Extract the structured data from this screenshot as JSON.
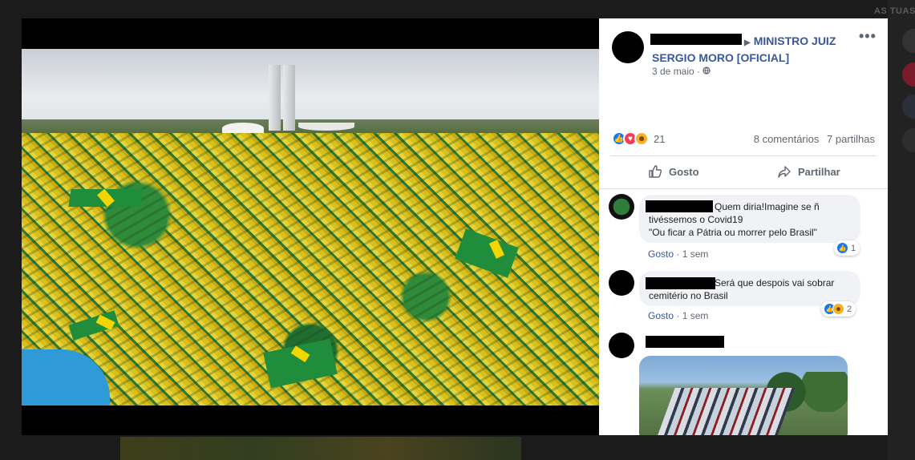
{
  "background": {
    "right_label": "AS TUAS"
  },
  "post": {
    "page_name": "MINISTRO JUIZ SERGIO MORO [OFICIAL]",
    "date": "3 de maio",
    "privacy_symbol": "·",
    "more_label": "•••",
    "reactions": {
      "icons": [
        "like-icon",
        "love-icon",
        "haha-icon"
      ],
      "count": "21"
    },
    "comments_count": "8 comentários",
    "shares_count": "7 partilhas",
    "actions": {
      "like_label": "Gosto",
      "share_label": "Partilhar"
    }
  },
  "comments": [
    {
      "text_line1": "Quem diria!Imagine se ñ",
      "text_line2": "tivéssemos o Covid19",
      "text_line3": "\"Ou ficar a Pátria ou morrer pelo Brasil\"",
      "like_label": "Gosto",
      "time": "1 sem",
      "reaction_count": "1"
    },
    {
      "text_line1": "Será que despois vai sobrar",
      "text_line2": "cemitério no Brasil",
      "like_label": "Gosto",
      "time": "1 sem",
      "reaction_count": "2"
    }
  ],
  "colors": {
    "link": "#385898",
    "like_blue": "#1877f2",
    "love_red": "#f33e58",
    "haha_yellow": "#f7b125"
  }
}
